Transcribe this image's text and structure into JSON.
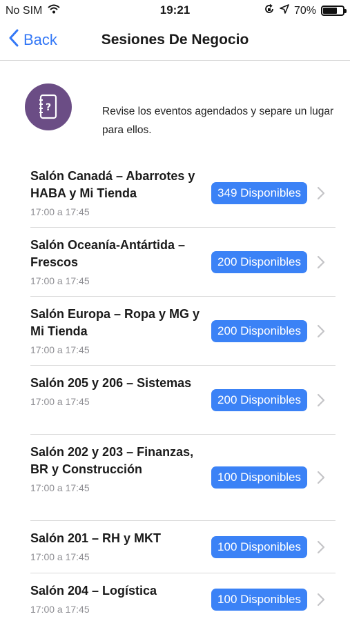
{
  "status_bar": {
    "carrier": "No SIM",
    "time": "19:21",
    "battery": "70%",
    "battery_level": 0.7
  },
  "nav": {
    "back_label": "Back",
    "title": "Sesiones De Negocio"
  },
  "intro": {
    "icon": "question-book-icon",
    "text": "Revise los eventos agendados y separe un lugar para ellos."
  },
  "sessions": [
    {
      "title": "Salón Canadá – Abarrotes y HABA y Mi Tienda",
      "time": "17:00 a 17:45",
      "badge": "349 Disponibles"
    },
    {
      "title": "Salón Oceanía-Antártida – Frescos",
      "time": "17:00 a 17:45",
      "badge": "200 Disponibles"
    },
    {
      "title": "Salón Europa – Ropa y MG y Mi Tienda",
      "time": "17:00 a 17:45",
      "badge": "200 Disponibles"
    },
    {
      "title": "Salón 205 y 206 – Sistemas",
      "time": "17:00 a 17:45",
      "badge": "200 Disponibles"
    },
    {
      "title": "Salón 202 y 203 – Finanzas, BR y Construcción",
      "time": "17:00 a 17:45",
      "badge": "100 Disponibles"
    },
    {
      "title": "Salón 201 – RH y MKT",
      "time": "17:00 a 17:45",
      "badge": "100 Disponibles"
    },
    {
      "title": "Salón 204 – Logística",
      "time": "17:00 a 17:45",
      "badge": "100 Disponibles"
    }
  ],
  "colors": {
    "accent": "#3478f6",
    "badge": "#3b82f6",
    "icon_bg": "#6b4d85"
  }
}
